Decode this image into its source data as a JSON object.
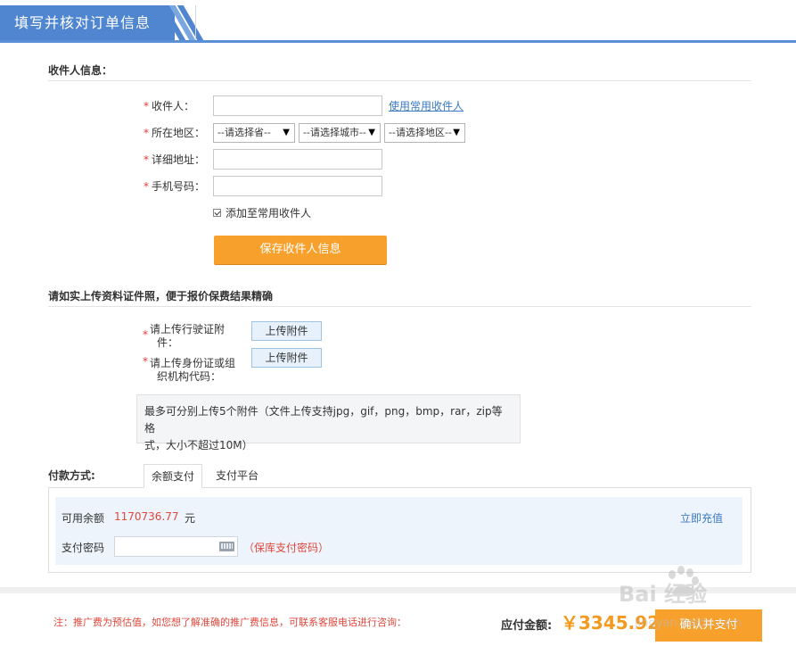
{
  "header": {
    "title": "填写并核对订单信息"
  },
  "recipient_section": {
    "title": "收件人信息：",
    "fields": {
      "name_label": "收件人：",
      "region_label": "所在地区：",
      "address_label": "详细地址：",
      "phone_label": "手机号码："
    },
    "use_common_link": "使用常用收件人",
    "selects": {
      "province": "--请选择省--",
      "city": "--请选择城市--",
      "district": "--请选择地区--"
    },
    "add_to_common": "添加至常用收件人",
    "save_button": "保存收件人信息"
  },
  "upload_section": {
    "title": "请如实上传资料证件照，便于报价保费结果精确",
    "license_label_1": "请上传行驶证附",
    "license_label_2": "件：",
    "id_label_1": "请上传身份证或组",
    "id_label_2": "织机构代码：",
    "upload_button": "上传附件",
    "note_line_1": "最多可分别上传5个附件（文件上传支持jpg，gif，png，bmp，rar，zip等格",
    "note_line_2": "式，大小不超过10M）"
  },
  "payment": {
    "title": "付款方式:",
    "tabs": [
      "余额支付",
      "支付平台"
    ],
    "balance_label": "可用余额",
    "balance_value": "1170736.77",
    "balance_unit": "元",
    "recharge_link": "立即充值",
    "password_label": "支付密码",
    "password_hint": "（保库支付密码）"
  },
  "footer": {
    "note": "注：推广费为预估值，如您想了解准确的推广费信息，可联系客服电话进行咨询：",
    "total_label": "应付金额:",
    "total_value": "￥3345.92",
    "confirm_button": "确认并支付"
  },
  "watermark": {
    "text": "Bai 经验",
    "url": "jingyan.baidu.com"
  },
  "colors": {
    "brand_blue": "#4f86cf",
    "orange": "#f7a02c",
    "required_red": "#e83a3a",
    "link_blue": "#3a79c4"
  }
}
